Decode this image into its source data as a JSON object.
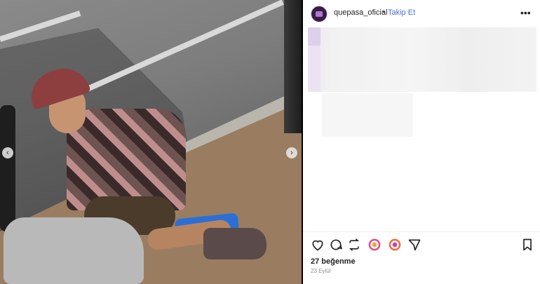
{
  "post": {
    "username": "quepasa_oficial",
    "separator": "•",
    "follow_label": "Takip Et",
    "more_glyph": "•••",
    "likes_text": "27 beğenme",
    "date_text": "23 Eylül"
  },
  "carousel": {
    "prev_glyph": "‹",
    "next_glyph": "›"
  },
  "icons": [
    "heart-icon",
    "comment-icon",
    "repost-icon",
    "sticker-icon",
    "sticker-alt-icon",
    "share-icon",
    "bookmark-icon"
  ],
  "colors": {
    "accent": "#4a6fd6",
    "text": "#222222",
    "muted": "#8e8e8e",
    "avatar_bg": "#3d1a4b"
  }
}
